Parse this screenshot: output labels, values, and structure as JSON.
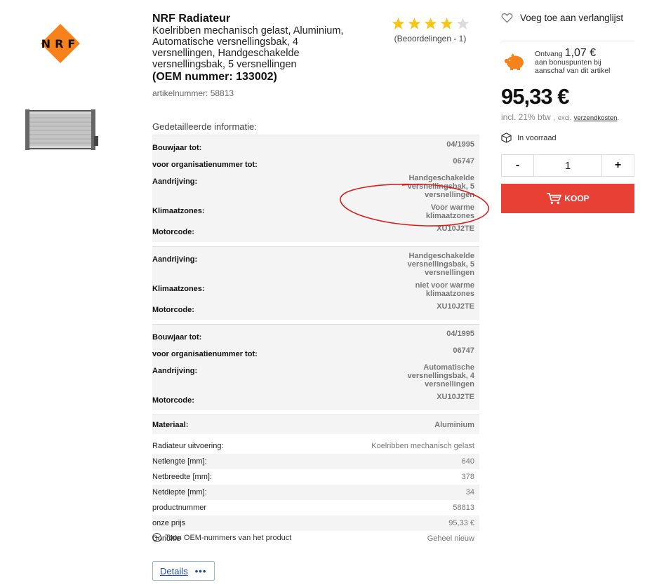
{
  "product": {
    "brand_title": "NRF Radiateur",
    "description_lines": [
      "Koelribben mechanisch gelast, Aluminium,",
      "Automatische versnellingsbak, 4",
      "versnellingen, Handgeschakelde",
      "versnellingsbak, 5 versnellingen"
    ],
    "oem_line": "(OEM nummer: 133002)",
    "article_number": "artikelnummer: 58813",
    "logo_text": "NRF",
    "logo_color": "#f7821b"
  },
  "rating": {
    "stars_filled": 4,
    "stars_total": 5,
    "count_text": "(Beoordelingen - 1)",
    "star_color": "#f5c518"
  },
  "details": {
    "title": "Gedetailleerde informatie:",
    "groups": [
      [
        {
          "k": "Bouwjaar tot:",
          "v": "04/1995"
        },
        {
          "k": "voor organisatienummer tot:",
          "v": "06747"
        },
        {
          "k": "Aandrijving:",
          "v": "Handgeschakelde versnellingsbak, 5 versnellingen"
        },
        {
          "k": "Klimaatzones:",
          "v": "Voor warme klimaatzones"
        },
        {
          "k": "Motorcode:",
          "v": "XU10J2TE"
        }
      ],
      [
        {
          "k": "Aandrijving:",
          "v": "Handgeschakelde versnellingsbak, 5 versnellingen"
        },
        {
          "k": "Klimaatzones:",
          "v": "niet voor warme klimaatzones"
        },
        {
          "k": "Motorcode:",
          "v": "XU10J2TE"
        }
      ],
      [
        {
          "k": "Bouwjaar tot:",
          "v": "04/1995"
        },
        {
          "k": "voor organisatienummer tot:",
          "v": "06747"
        },
        {
          "k": "Aandrijving:",
          "v": "Automatische versnellingsbak, 4 versnellingen"
        },
        {
          "k": "Motorcode:",
          "v": "XU10J2TE"
        }
      ]
    ],
    "material": {
      "k": "Materiaal:",
      "v": "Aluminium"
    },
    "properties": [
      {
        "k": "Radiateur uitvoering:",
        "v": "Koelribben mechanisch gelast"
      },
      {
        "k": "Netlengte [mm]:",
        "v": "640"
      },
      {
        "k": "Netbreedte [mm]:",
        "v": "378"
      },
      {
        "k": "Netdiepte [mm]:",
        "v": "34"
      },
      {
        "k": "productnummer",
        "v": "58813"
      },
      {
        "k": "onze prijs",
        "v": "95,33 €"
      },
      {
        "k": "Conditie",
        "v": "Geheel nieuw"
      }
    ],
    "oem_toggle": "Toon OEM-nummers van het product",
    "details_button": "Details",
    "details_more": "•••"
  },
  "sidebar": {
    "wishlist": "Voeg toe aan verlanglijst",
    "bonus_prefix": "Ontvang",
    "bonus_amount": "1,07 €",
    "bonus_line2": "aan bonuspunten bij",
    "bonus_line3": "aanschaf van dit artikel",
    "price": "95,33 €",
    "vat_main": "incl. 21% btw ,",
    "vat_excl": "excl.",
    "vat_link": "verzendkosten",
    "vat_end": ".",
    "stock": "In voorraad",
    "qty_minus": "-",
    "qty_value": "1",
    "qty_plus": "+",
    "buy_label": "KOOP",
    "buy_color": "#e84034",
    "bonus_icon": "piggy-bank-icon"
  }
}
